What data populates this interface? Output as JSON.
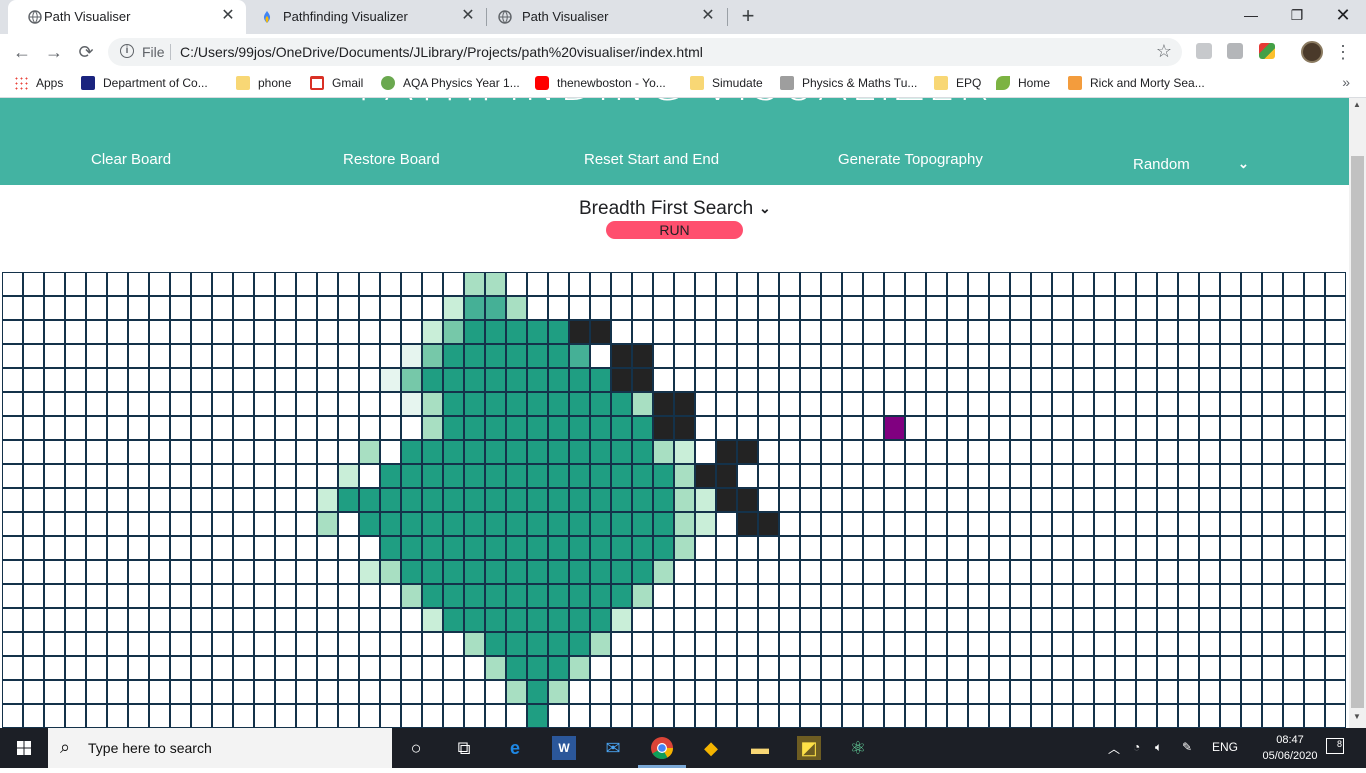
{
  "browser": {
    "tabs": [
      {
        "title": "Path Visualiser",
        "active": true
      },
      {
        "title": "Pathfinding Visualizer",
        "active": false
      },
      {
        "title": "Path Visualiser",
        "active": false
      }
    ],
    "file_label": "File",
    "url": "C:/Users/99jos/OneDrive/Documents/JLibrary/Projects/path%20visualiser/index.html",
    "bookmarks": [
      {
        "label": "Apps",
        "icon": "apps-grid-icon"
      },
      {
        "label": "Department of Co...",
        "icon": "shield-icon"
      },
      {
        "label": "phone",
        "icon": "folder-icon"
      },
      {
        "label": "Gmail",
        "icon": "gmail-icon"
      },
      {
        "label": "AQA Physics Year 1...",
        "icon": "k-icon"
      },
      {
        "label": "thenewboston - Yo...",
        "icon": "youtube-icon"
      },
      {
        "label": "Simudate",
        "icon": "folder-icon"
      },
      {
        "label": "Physics & Maths Tu...",
        "icon": "pmt-icon"
      },
      {
        "label": "EPQ",
        "icon": "folder-icon"
      },
      {
        "label": "Home",
        "icon": "leaf-icon"
      },
      {
        "label": "Rick and Morty Sea...",
        "icon": "k-orange-icon"
      }
    ]
  },
  "page": {
    "title": "PATHFINDING VISUALIZER",
    "nav": {
      "clear": "Clear Board",
      "restore": "Restore Board",
      "reset": "Reset Start and End",
      "topography": "Generate Topography",
      "maze_select": "Random"
    },
    "algorithm": "Breadth First Search",
    "run": "RUN",
    "grid": {
      "columns": 64,
      "rows": 19,
      "legend": {
        "0": "empty",
        "1": "visited-faint",
        "2": "visited-light",
        "3": "visited",
        "4": "visited-mid",
        "5": "visited-deep",
        "6": "visited-full",
        "W": "wall",
        "T": "target"
      },
      "cells": [
        "0000000000000000000000330000000000000000000000000000000000000000",
        "0000000000000000000002553000000000000000000000000000000000000000",
        "000000000000000000002466666WW00000000000000000000000000000000000",
        "00000000000000000001466666650WW000000000000000000000000000000000",
        "00000000000000000014666666666WW000000000000000000000000000000000",
        "0000000000000000000136666666663WW0000000000000000000000000000000",
        "0000000000000000000036666666666WW000000000T000000000000000000000",
        "0000000000000000030666666666666320WW0000000000000000000000000000",
        "000000000000000020666666666666663WW00000000000000000000000000000",
        "0000000000000002666666666666666632WW0000000000000000000000000000",
        "00000000000000030666666666666666320WW000000000000000000000000000",
        "0000000000000000006666666666666630000000000000000000000000000000",
        "0000000000000000023666666666666300000000000000000000000000000000",
        "0000000000000000000366666666663000000000000000000000000000000000",
        "0000000000000000000026666666620000000000000000000000000000000000",
        "0000000000000000000000366666300000000000000000000000000000000000",
        "0000000000000000000000036663000000000000000000000000000000000000",
        "0000000000000000000000003630000000000000000000000000000000000000",
        "0000000000000000000000000600000000000000000000000000000000000000"
      ]
    }
  },
  "taskbar": {
    "search_placeholder": "Type here to search",
    "language": "ENG",
    "time": "08:47",
    "date": "05/06/2020",
    "notifications": "8"
  },
  "colors": {
    "navbar": "#43b3a2",
    "run_button": "#ff4f6e",
    "wall": "#232323",
    "target": "#800080",
    "visited_full": "#1f9e82"
  }
}
